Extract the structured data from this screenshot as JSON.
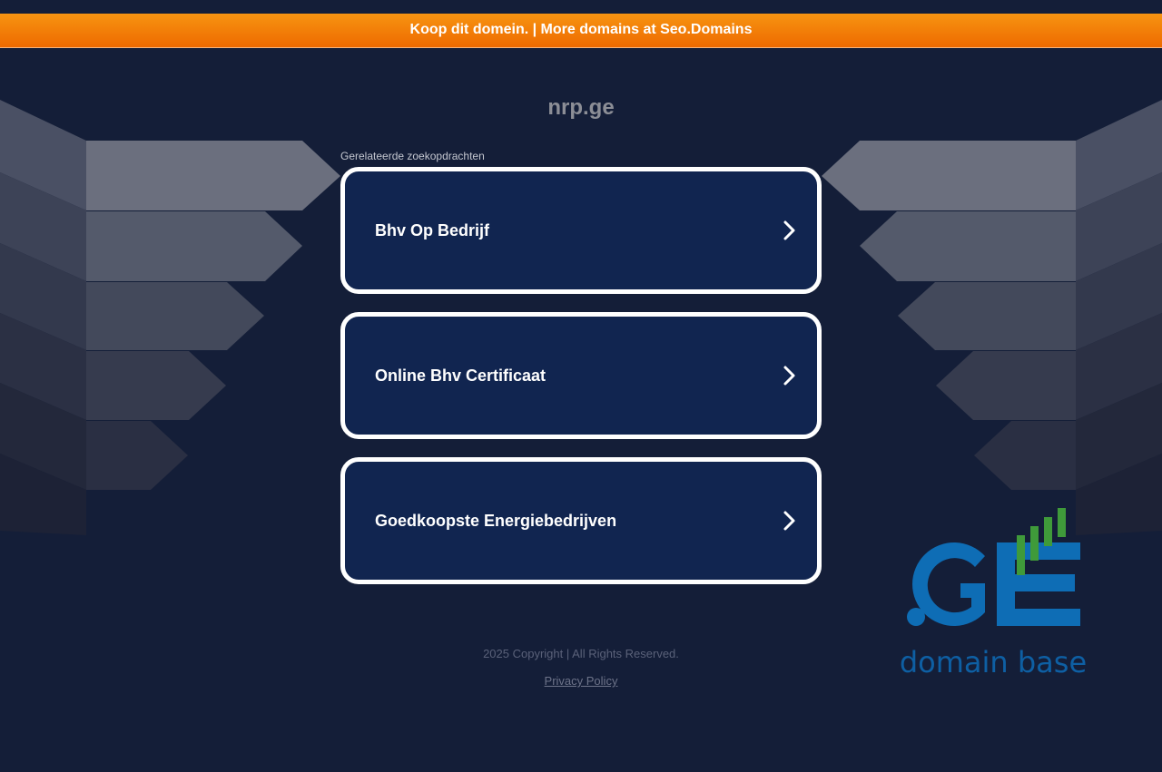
{
  "banner": {
    "text": "Koop dit domein. | More domains at Seo.Domains"
  },
  "domain": {
    "name": "nrp.ge"
  },
  "related": {
    "label": "Gerelateerde zoekopdrachten",
    "items": [
      {
        "label": "Bhv Op Bedrijf"
      },
      {
        "label": "Online Bhv Certificaat"
      },
      {
        "label": "Goedkoopste Energiebedrijven"
      }
    ]
  },
  "footer": {
    "copyright": "2025 Copyright | All Rights Reserved.",
    "privacy_label": "Privacy Policy"
  },
  "logo": {
    "mark": ".GE",
    "tagline": "domain base"
  },
  "colors": {
    "background": "#141e38",
    "banner_top": "#f79411",
    "banner_bottom": "#ee6a00",
    "card_fill": "#112550",
    "card_border": "#ffffff",
    "logo_blue": "#0e6db5",
    "logo_green": "#3f9a3a"
  },
  "icons": {
    "card_arrow": "chevron-right-icon"
  }
}
